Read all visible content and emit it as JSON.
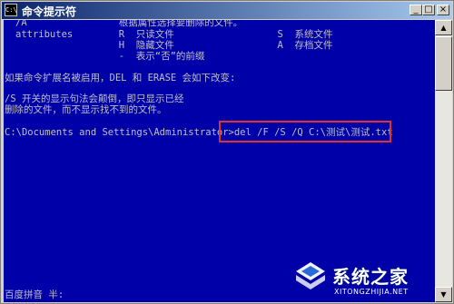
{
  "window": {
    "title": "命令提示符",
    "icon_text": "C:\\",
    "buttons": {
      "minimize": "_",
      "maximize": "□",
      "close": "×"
    }
  },
  "console": {
    "lines": [
      {
        "text": "/A                根据属性选择要删除的文件。"
      },
      {
        "text": "attributes        R  只读文件                  S  系统文件"
      },
      {
        "text": "                  H  隐藏文件                  A  存档文件"
      },
      {
        "text": "                  -  表示“否”的前缀"
      },
      {
        "text": "如果命令扩展名被启用，DEL 和 ERASE 会如下改变:"
      },
      {
        "text": "/S 开关的显示句法会颠倒，即只显示已经"
      },
      {
        "text": "删除的文件，而不显示找不到的文件。"
      },
      {
        "text": "C:\\Documents and Settings\\Administrator>del /F /S /Q C:\\测试\\测试.txt"
      }
    ],
    "ime_status": "百度拼音 半:"
  },
  "colors": {
    "console_bg": "#0000a8",
    "console_text": "#c0c0c0",
    "highlight_box": "#e03030"
  },
  "watermark": {
    "main": "系统之家",
    "url": "XITONGZHIJIA.NET"
  }
}
